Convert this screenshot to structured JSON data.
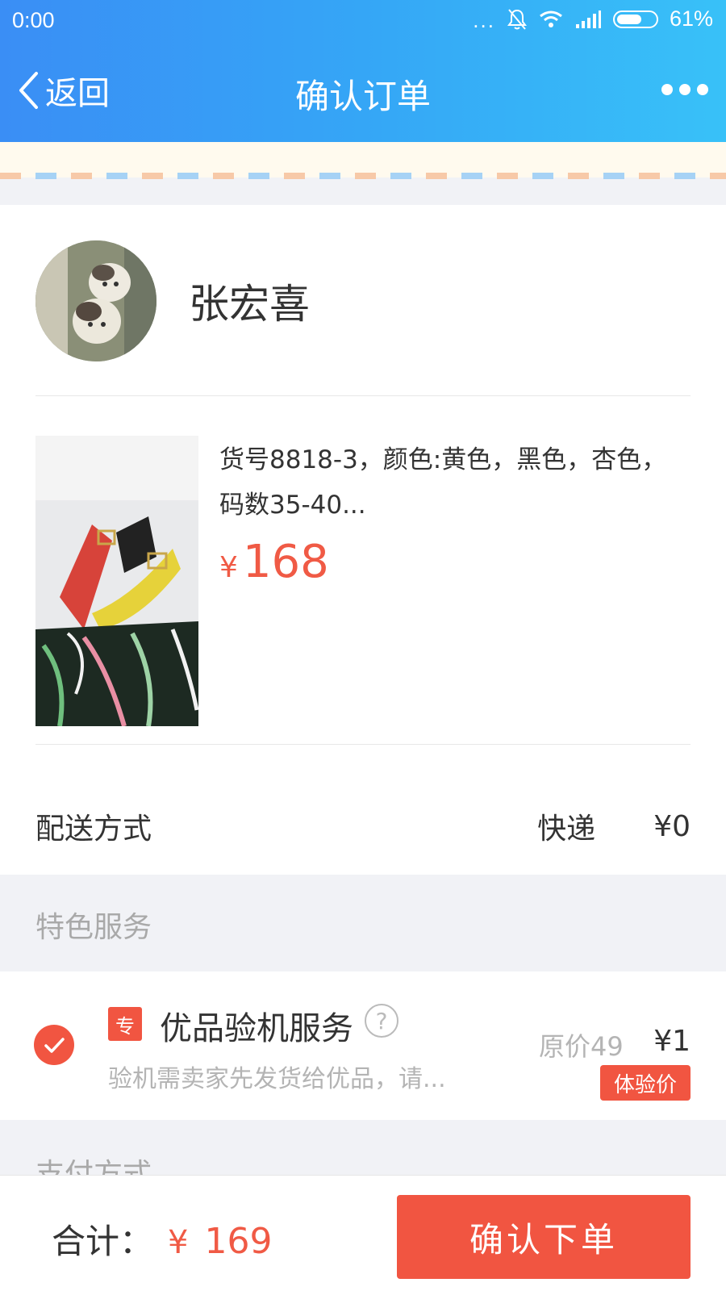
{
  "status_bar": {
    "time": "0:00",
    "dots": "...",
    "battery": "61%"
  },
  "nav": {
    "back_label": "返回",
    "title": "确认订单"
  },
  "seller": {
    "name": "张宏喜"
  },
  "product": {
    "description": "货号8818-3，颜色:黄色，黑色，杏色，码数35-40...",
    "currency": "¥",
    "price": "168"
  },
  "shipping": {
    "label": "配送方式",
    "method": "快递",
    "price": "¥0"
  },
  "special_services": {
    "header": "特色服务",
    "item": {
      "tag": "专",
      "title": "优品验机服务",
      "help": "?",
      "description": "验机需卖家先发货给优品，请...",
      "original_price": "原价49",
      "price": "¥1",
      "badge": "体验价",
      "checked": true
    }
  },
  "payment": {
    "header": "支付方式"
  },
  "footer": {
    "total_label": "合计：",
    "currency": "¥",
    "total": "169",
    "confirm_label": "确认下单"
  },
  "colors": {
    "accent": "#f15541",
    "header_start": "#3a8ef5",
    "header_end": "#38c1f8"
  }
}
